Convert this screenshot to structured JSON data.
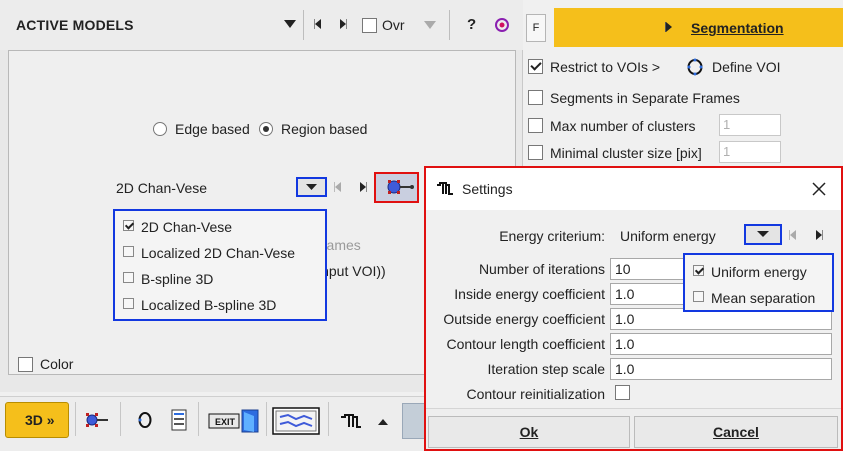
{
  "active_models": {
    "title": "ACTIVE MODELS",
    "ovr_label": "Ovr",
    "ovr_checked": false,
    "help_label": "?",
    "radio_edge_label": "Edge based",
    "radio_region_label": "Region based",
    "selected_mode": "Region based",
    "model_dropdown_value": "2D Chan-Vese",
    "model_options": [
      {
        "label": "2D Chan-Vese",
        "checked": true
      },
      {
        "label": "Localized 2D Chan-Vese",
        "checked": false
      },
      {
        "label": "B-spline 3D",
        "checked": false
      },
      {
        "label": "Localized B-spline 3D",
        "checked": false
      }
    ],
    "ghost_frames_text": "frames",
    "ghost_input_voi_text": "input VOI))",
    "color_label": "Color",
    "color_checked": false
  },
  "segmentation": {
    "f_button_label": "F",
    "seg_button_label": "Segmentation",
    "restrict_label": "Restrict to VOIs >",
    "restrict_checked": true,
    "define_voi_label": "Define VOI",
    "separate_frames_label": "Segments in Separate Frames",
    "max_clusters_label": "Max number of clusters",
    "max_clusters_value": "1",
    "min_cluster_label": "Minimal cluster size [pix]",
    "min_cluster_value": "1"
  },
  "toolbar": {
    "btn_3d_label": "3D »",
    "exit_label": "EXIT"
  },
  "settings_dialog": {
    "title": "Settings",
    "energy_label": "Energy criterium:",
    "energy_value": "Uniform energy",
    "energy_options": [
      {
        "label": "Uniform energy",
        "checked": true
      },
      {
        "label": "Mean separation",
        "checked": false
      }
    ],
    "fields": [
      {
        "label": "Number of iterations",
        "value": "10"
      },
      {
        "label": "Inside energy coefficient",
        "value": "1.0"
      },
      {
        "label": "Outside energy coefficient",
        "value": "1.0"
      },
      {
        "label": "Contour length coefficient",
        "value": "1.0"
      },
      {
        "label": "Iteration step scale",
        "value": "1.0"
      }
    ],
    "reinit_label": "Contour reinitialization",
    "reinit_checked": false,
    "ok_label": "Ok",
    "cancel_label": "Cancel"
  },
  "colors": {
    "accent_yellow": "#f5bf1b",
    "highlight_blue": "#1238e0",
    "highlight_red": "#e01010"
  }
}
